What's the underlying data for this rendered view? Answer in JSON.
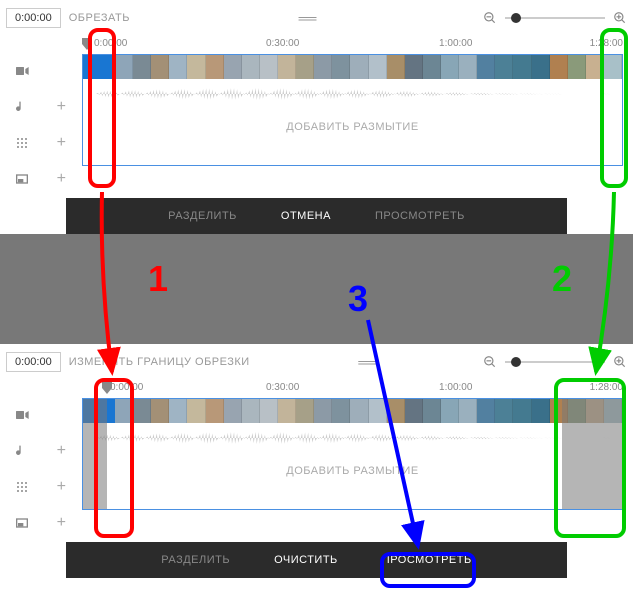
{
  "panel1": {
    "time": "0:00:00",
    "mode": "ОБРЕЗАТЬ",
    "ruler": {
      "t0": "0:00:00",
      "t1": "0:30:00",
      "t2": "1:00:00",
      "t3": "1:28:00"
    },
    "blur_label": "ДОБАВИТЬ РАЗМЫТИЕ",
    "actions": {
      "split": "РАЗДЕЛИТЬ",
      "cancel": "ОТМЕНА",
      "preview": "ПРОСМОТРЕТЬ"
    }
  },
  "panel2": {
    "time": "0:00:00",
    "mode": "ИЗМЕНИТЬ ГРАНИЦУ ОБРЕЗКИ",
    "ruler": {
      "t0": "0:00:00",
      "t1": "0:30:00",
      "t2": "1:00:00",
      "t3": "1:28:00"
    },
    "blur_label": "ДОБАВИТЬ РАЗМЫТИЕ",
    "actions": {
      "split": "РАЗДЕЛИТЬ",
      "clear": "ОЧИСТИТЬ",
      "preview": "ПРОСМОТРЕТЬ"
    }
  },
  "annotations": {
    "n1": "1",
    "n2": "2",
    "n3": "3"
  },
  "thumb_colors": [
    "#8ea5b8",
    "#7a8a94",
    "#a39076",
    "#9fb4c4",
    "#c4b89c",
    "#b89878",
    "#98a4b0",
    "#aab6be",
    "#b8c0c6",
    "#c2b49a",
    "#a6a088",
    "#8c9aa6",
    "#7e929e",
    "#9eaeba",
    "#b2c0ca",
    "#a88e68",
    "#647482",
    "#6c8694",
    "#88a6b6",
    "#9ab0be",
    "#5280a0",
    "#4c8096",
    "#447a90",
    "#3a708a",
    "#b08050",
    "#8a9a7a",
    "#c8b090",
    "#a8c0c8"
  ]
}
